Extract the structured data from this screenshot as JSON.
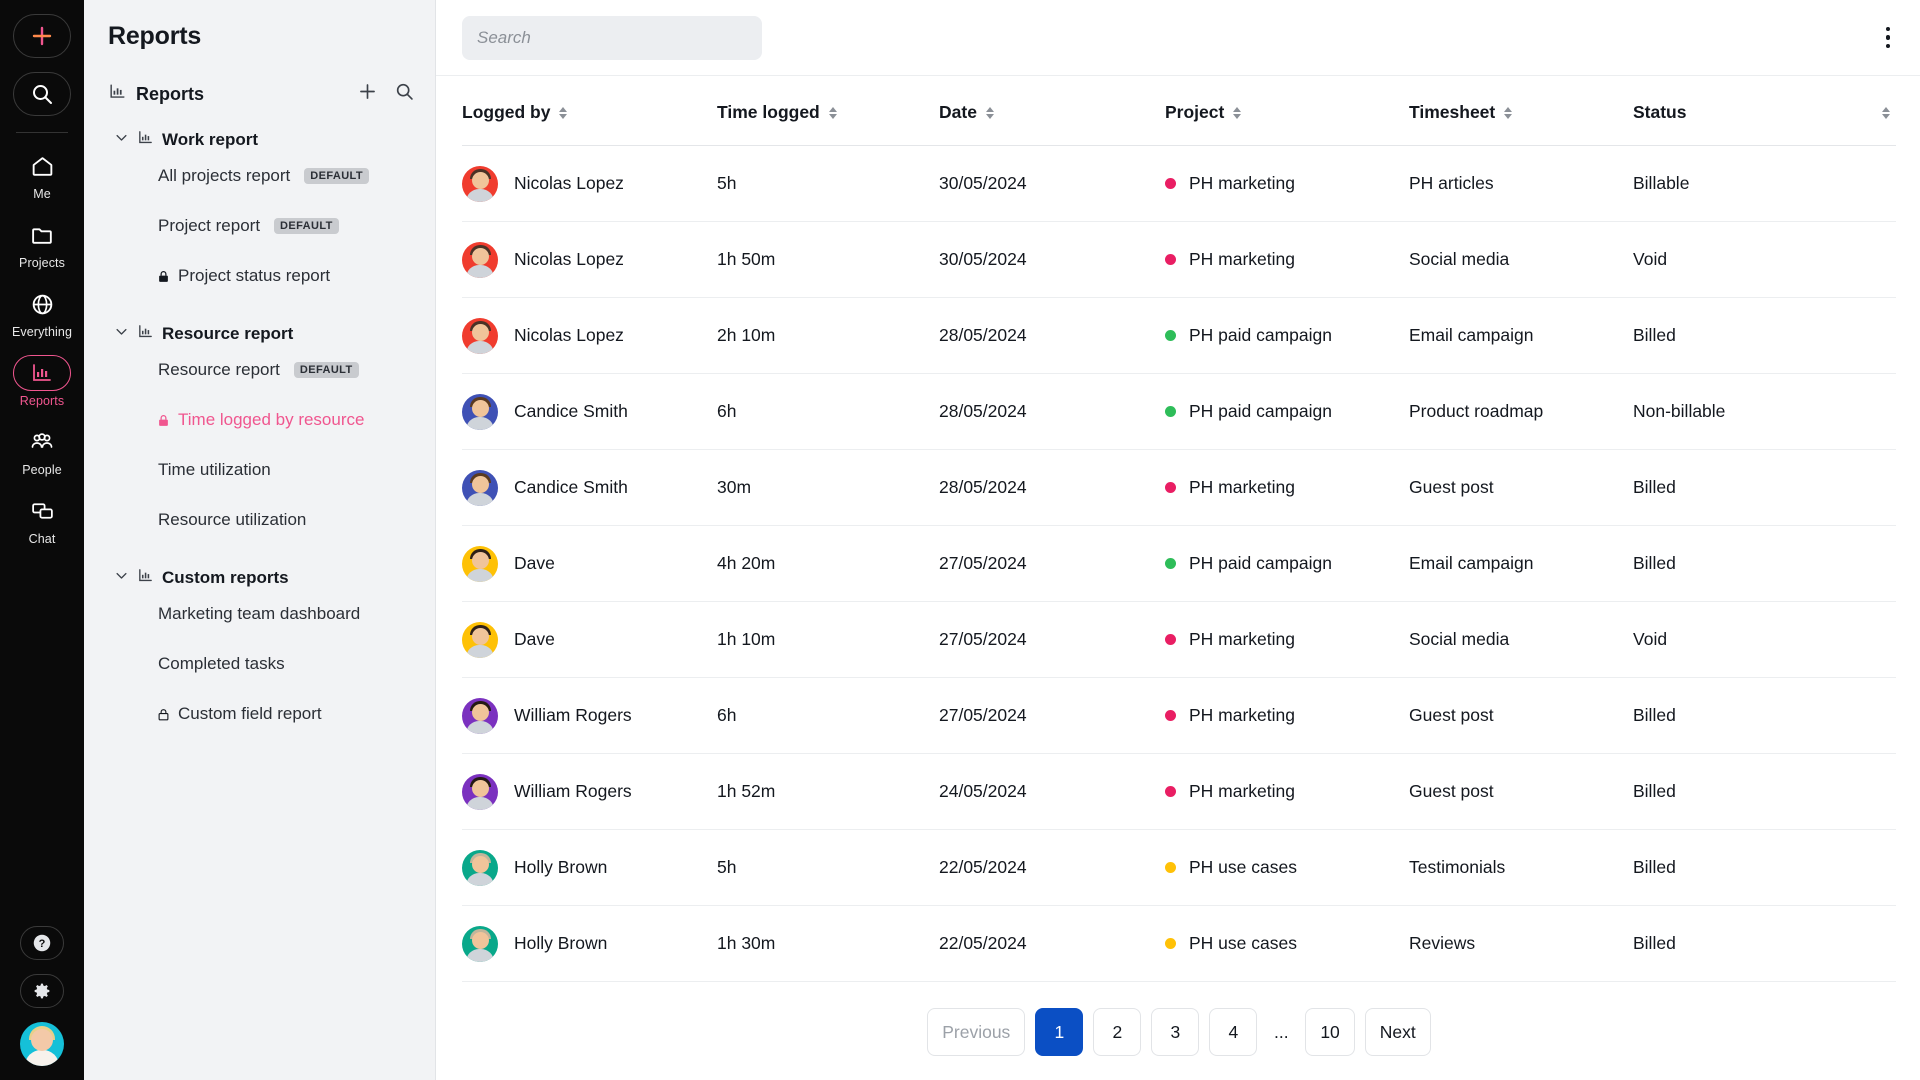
{
  "rail": {
    "add_label": "add-new",
    "search_label": "search",
    "items": [
      {
        "label": "Me",
        "icon": "home-icon",
        "active": false
      },
      {
        "label": "Projects",
        "icon": "folder-icon",
        "active": false
      },
      {
        "label": "Everything",
        "icon": "globe-icon",
        "active": false
      },
      {
        "label": "Reports",
        "icon": "bar-chart-icon",
        "active": true
      },
      {
        "label": "People",
        "icon": "people-icon",
        "active": false
      },
      {
        "label": "Chat",
        "icon": "chat-icon",
        "active": false
      }
    ],
    "bottom": [
      {
        "label": "Help",
        "icon": "question-icon"
      },
      {
        "label": "Settings",
        "icon": "gear-icon"
      }
    ],
    "avatar_label": "user-avatar"
  },
  "sidebar": {
    "title": "Reports",
    "root_label": "Reports",
    "add_label": "+",
    "groups": [
      {
        "label": "Work report",
        "items": [
          {
            "label": "All projects report",
            "badge": "DEFAULT",
            "locked": false,
            "active": false
          },
          {
            "label": "Project report",
            "badge": "DEFAULT",
            "locked": false,
            "active": false
          },
          {
            "label": "Project status report",
            "badge": "",
            "locked": true,
            "active": false
          }
        ]
      },
      {
        "label": "Resource report",
        "items": [
          {
            "label": "Resource report",
            "badge": "DEFAULT",
            "locked": false,
            "active": false
          },
          {
            "label": "Time logged by resource",
            "badge": "",
            "locked": true,
            "active": true
          },
          {
            "label": "Time utilization",
            "badge": "",
            "locked": false,
            "active": false
          },
          {
            "label": "Resource utilization",
            "badge": "",
            "locked": false,
            "active": false
          }
        ]
      },
      {
        "label": "Custom reports",
        "items": [
          {
            "label": "Marketing team dashboard",
            "badge": "",
            "locked": false,
            "active": false
          },
          {
            "label": "Completed tasks",
            "badge": "",
            "locked": false,
            "active": false
          },
          {
            "label": "Custom field report",
            "badge": "",
            "locked": true,
            "active": false
          }
        ]
      }
    ]
  },
  "topbar": {
    "search_placeholder": "Search",
    "search_value": "",
    "menu_label": "more-options"
  },
  "table": {
    "columns": [
      {
        "label": "Logged by",
        "sortable": true
      },
      {
        "label": "Time logged",
        "sortable": true
      },
      {
        "label": "Date",
        "sortable": true
      },
      {
        "label": "Project",
        "sortable": true
      },
      {
        "label": "Timesheet",
        "sortable": true
      },
      {
        "label": "Status",
        "sortable": true
      }
    ],
    "rows": [
      {
        "user": "Nicolas Lopez",
        "avatar_color": "#f03c2e",
        "hair": "#4a3226",
        "time": "5h",
        "date": "30/05/2024",
        "project": "PH marketing",
        "project_color": "#e91e63",
        "timesheet": "PH articles",
        "status": "Billable"
      },
      {
        "user": "Nicolas Lopez",
        "avatar_color": "#f03c2e",
        "hair": "#4a3226",
        "time": "1h 50m",
        "date": "30/05/2024",
        "project": "PH marketing",
        "project_color": "#e91e63",
        "timesheet": "Social media",
        "status": "Void"
      },
      {
        "user": "Nicolas Lopez",
        "avatar_color": "#f03c2e",
        "hair": "#4a3226",
        "time": "2h 10m",
        "date": "28/05/2024",
        "project": "PH paid campaign",
        "project_color": "#2ebd59",
        "timesheet": "Email campaign",
        "status": "Billed"
      },
      {
        "user": "Candice Smith",
        "avatar_color": "#3f51b5",
        "hair": "#5a3a20",
        "time": "6h",
        "date": "28/05/2024",
        "project": "PH paid campaign",
        "project_color": "#2ebd59",
        "timesheet": "Product roadmap",
        "status": "Non-billable"
      },
      {
        "user": "Candice Smith",
        "avatar_color": "#3f51b5",
        "hair": "#5a3a20",
        "time": "30m",
        "date": "28/05/2024",
        "project": "PH marketing",
        "project_color": "#e91e63",
        "timesheet": "Guest post",
        "status": "Billed"
      },
      {
        "user": "Dave",
        "avatar_color": "#fec106",
        "hair": "#2e2118",
        "time": "4h 20m",
        "date": "27/05/2024",
        "project": "PH paid campaign",
        "project_color": "#2ebd59",
        "timesheet": "Email campaign",
        "status": "Billed"
      },
      {
        "user": "Dave",
        "avatar_color": "#fec106",
        "hair": "#2e2118",
        "time": "1h 10m",
        "date": "27/05/2024",
        "project": "PH marketing",
        "project_color": "#e91e63",
        "timesheet": "Social media",
        "status": "Void"
      },
      {
        "user": "William Rogers",
        "avatar_color": "#7b31bf",
        "hair": "#241a14",
        "time": "6h",
        "date": "27/05/2024",
        "project": "PH marketing",
        "project_color": "#e91e63",
        "timesheet": "Guest post",
        "status": "Billed"
      },
      {
        "user": "William Rogers",
        "avatar_color": "#7b31bf",
        "hair": "#241a14",
        "time": "1h 52m",
        "date": "24/05/2024",
        "project": "PH marketing",
        "project_color": "#e91e63",
        "timesheet": "Guest post",
        "status": "Billed"
      },
      {
        "user": "Holly Brown",
        "avatar_color": "#09a88a",
        "hair": "#c2b59b",
        "time": "5h",
        "date": "22/05/2024",
        "project": "PH use cases",
        "project_color": "#ffc107",
        "timesheet": "Testimonials",
        "status": "Billed"
      },
      {
        "user": "Holly Brown",
        "avatar_color": "#09a88a",
        "hair": "#c2b59b",
        "time": "1h 30m",
        "date": "22/05/2024",
        "project": "PH use cases",
        "project_color": "#ffc107",
        "timesheet": "Reviews",
        "status": "Billed"
      }
    ]
  },
  "pagination": {
    "previous_label": "Previous",
    "next_label": "Next",
    "ellipsis": "...",
    "current_page": "1",
    "pages": [
      "1",
      "2",
      "3",
      "4"
    ],
    "last_page": "10"
  },
  "colors": {
    "accent_pink": "#f0568f",
    "active_blue": "#0b4fc4",
    "project_pink": "#e91e63",
    "project_green": "#2ebd59",
    "project_yellow": "#ffc107"
  }
}
